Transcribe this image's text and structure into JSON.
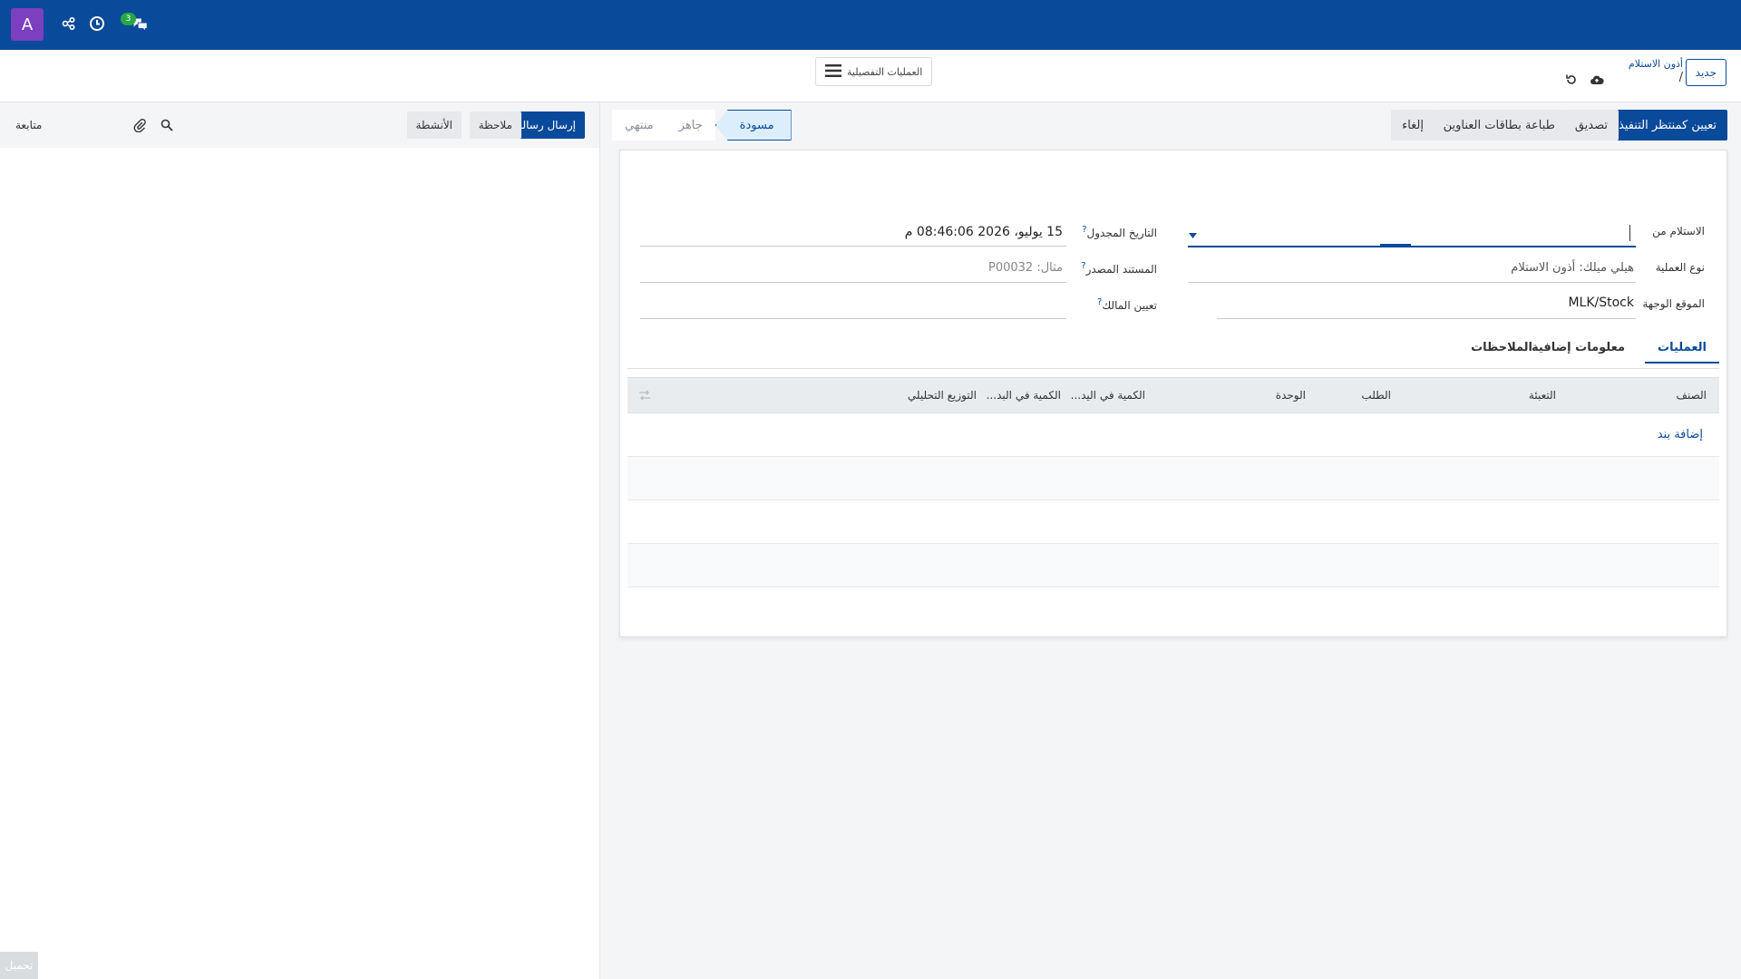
{
  "navbar": {
    "avatar_letter": "A",
    "messages_count": "3",
    "icons": [
      "network-icon",
      "clock-icon",
      "chat-icon"
    ]
  },
  "control": {
    "new_label": "جديد",
    "breadcrumb_parent": "أذون الاستلام",
    "breadcrumb_current": "/",
    "gear_label": "العمليات التفصيلية"
  },
  "actions": {
    "set_ready": "تعيين كمنتظر التنفيذ",
    "validate": "تصديق",
    "print_labels": "طباعة بطاقات العناوين",
    "cancel": "إلغاء"
  },
  "status": {
    "steps": [
      "منتهي",
      "جاهز",
      "مسودة"
    ],
    "active": "مسودة"
  },
  "form": {
    "receive_from_label": "الاستلام من",
    "receive_from_value": "",
    "operation_type_label": "نوع العملية",
    "operation_type_value": "هيلي ميلك: أذون الاستلام",
    "dest_location_label": "الموقع الوجهة",
    "dest_location_value": "MLK/Stock",
    "scheduled_date_label": "التاريخ المجدول",
    "scheduled_date_value": "15 يوليو، 2026 08:46:06 م",
    "source_doc_label": "المستند المصدر",
    "source_doc_placeholder": "مثال: P00032",
    "assign_owner_label": "تعيين المالك",
    "help_mark": "?"
  },
  "tabs": [
    "العمليات",
    "معلومات إضافية",
    "الملاحظات"
  ],
  "table": {
    "headers": [
      "الصنف",
      "التعبئة",
      "الطلب",
      "الوحدة",
      "الكمية في اليد...",
      "الكمية في البد...",
      "التوزيع التحليلي"
    ],
    "add_line": "إضافة بند"
  },
  "chatter": {
    "send_message": "إرسال رسالة",
    "log_note": "ملاحظة",
    "activities": "الأنشطة",
    "follow": "متابعة",
    "loading": "تحميل"
  }
}
